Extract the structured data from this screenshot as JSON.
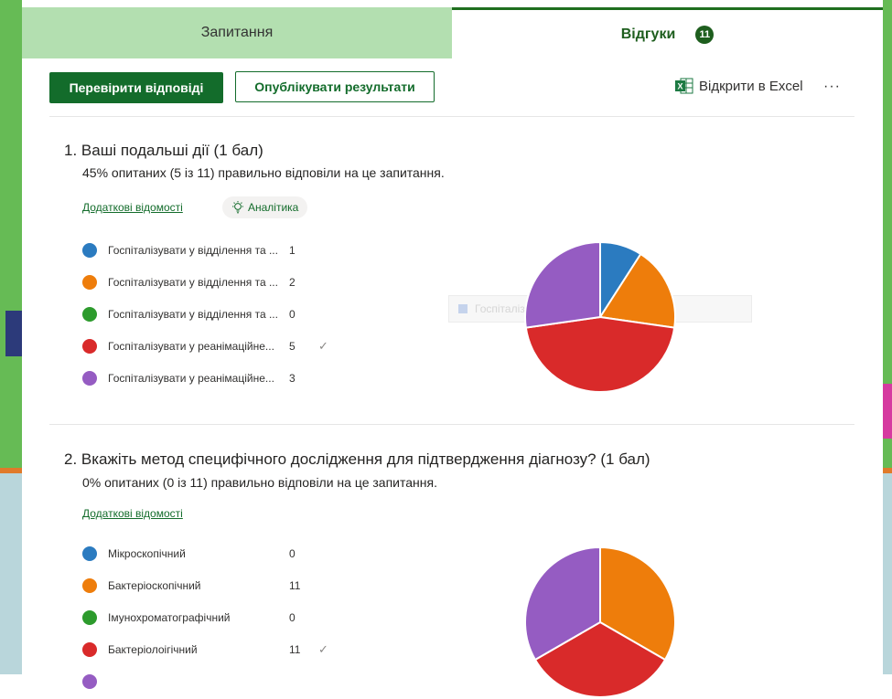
{
  "tabs": {
    "questions_label": "Запитання",
    "responses_label": "Відгуки",
    "responses_count": "11"
  },
  "toolbar": {
    "review_label": "Перевірити відповіді",
    "publish_label": "Опублікувати результати",
    "excel_label": "Відкрити в Excel",
    "more_label": "···"
  },
  "colors": {
    "blue": "#2b7bc0",
    "orange": "#ee7d0b",
    "green": "#2d9b2d",
    "red": "#d92a2a",
    "purple": "#955cc2",
    "brand": "#136c2b"
  },
  "questions": [
    {
      "title": "1.  Ваші подальші дії (1 бал)",
      "summary": "45% опитаних (5 із 11) правильно відповіли на це запитання.",
      "details_link": "Додаткові відомості",
      "analytics_label": "Аналітика",
      "tooltip_text": "Госпіталізувати у відділення та ...",
      "options": [
        {
          "label": "Госпіталізувати у відділення та ...",
          "count": "1",
          "correct": false
        },
        {
          "label": "Госпіталізувати у відділення та ...",
          "count": "2",
          "correct": false
        },
        {
          "label": "Госпіталізувати у відділення та ...",
          "count": "0",
          "correct": false
        },
        {
          "label": "Госпіталізувати у реанімаційне...",
          "count": "5",
          "correct": true
        },
        {
          "label": "Госпіталізувати у реанімаційне...",
          "count": "3",
          "correct": false
        }
      ]
    },
    {
      "title": "2.  Вкажіть метод специфічного дослідження для підтвердження діагнозу? (1 бал)",
      "summary": "0% опитаних (0 із 11) правильно відповіли на це запитання.",
      "details_link": "Додаткові відомості",
      "options": [
        {
          "label": "Мікроскопічний",
          "count": "0",
          "correct": false
        },
        {
          "label": "Бактеріоскопічний",
          "count": "11",
          "correct": false
        },
        {
          "label": "Імунохроматографічний",
          "count": "0",
          "correct": false
        },
        {
          "label": "Бактеріолоігічний",
          "count": "11",
          "correct": true
        }
      ]
    }
  ],
  "chart_data": [
    {
      "type": "pie",
      "categories": [
        "Госпіталізувати у відділення та ...",
        "Госпіталізувати у відділення та ...",
        "Госпіталізувати у відділення та ...",
        "Госпіталізувати у реанімаційне...",
        "Госпіталізувати у реанімаційне..."
      ],
      "values": [
        1,
        2,
        0,
        5,
        3
      ],
      "colors": [
        "#2b7bc0",
        "#ee7d0b",
        "#2d9b2d",
        "#d92a2a",
        "#955cc2"
      ]
    },
    {
      "type": "pie",
      "categories": [
        "Мікроскопічний",
        "Бактеріоскопічний",
        "Імунохроматографічний",
        "Бактеріолоігічний",
        ""
      ],
      "values": [
        0,
        11,
        0,
        11,
        11
      ],
      "colors": [
        "#2b7bc0",
        "#ee7d0b",
        "#2d9b2d",
        "#d92a2a",
        "#955cc2"
      ]
    }
  ]
}
